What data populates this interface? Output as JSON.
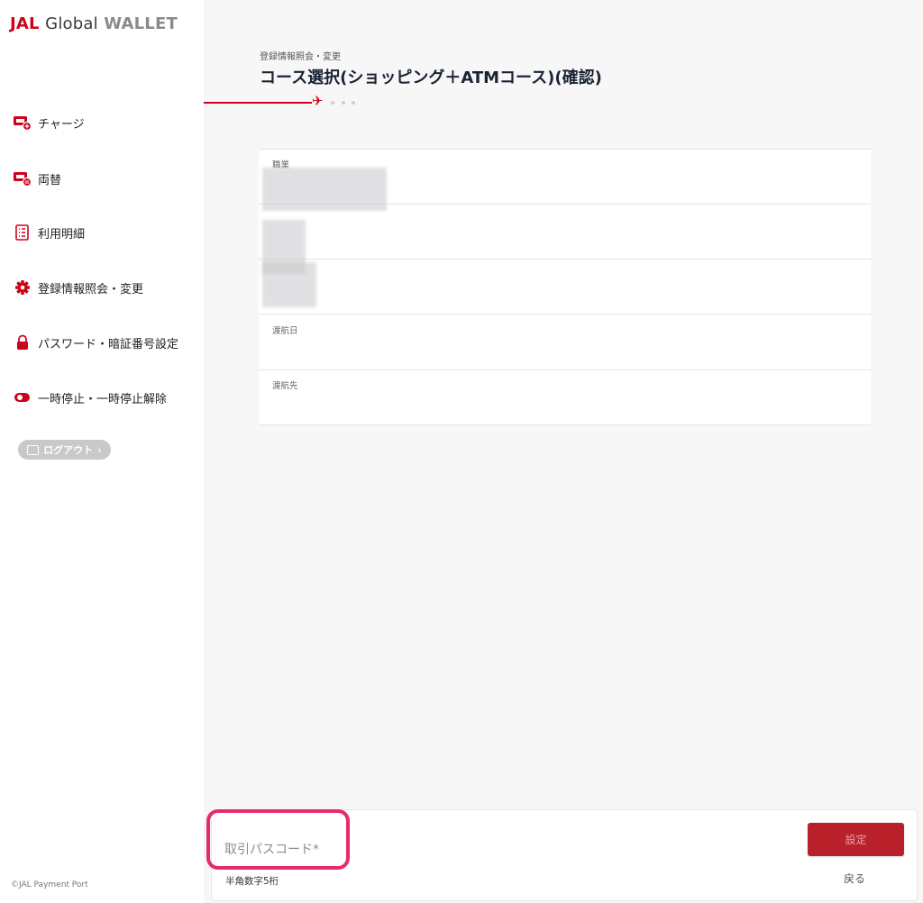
{
  "logo": {
    "jal": "JAL",
    "global": "Global",
    "wallet": "WALLET"
  },
  "sidebar": {
    "items": [
      {
        "label": "チャージ",
        "icon": "charge-icon"
      },
      {
        "label": "両替",
        "icon": "exchange-icon"
      },
      {
        "label": "利用明細",
        "icon": "statement-icon"
      },
      {
        "label": "登録情報照会・変更",
        "icon": "gear-icon"
      },
      {
        "label": "パスワード・暗証番号設定",
        "icon": "lock-icon"
      },
      {
        "label": "一時停止・一時停止解除",
        "icon": "toggle-icon"
      }
    ],
    "logout_label": "ログアウト",
    "copyright": "©JAL Payment Port"
  },
  "main": {
    "breadcrumb": "登録情報照会・変更",
    "title": "コース選択(ショッピング＋ATMコース)(確認)",
    "fields": [
      {
        "label": "職業",
        "value": ""
      },
      {
        "label": "",
        "value": ""
      },
      {
        "label": "",
        "value": ""
      },
      {
        "label": "渡航日",
        "value": ""
      },
      {
        "label": "渡航先",
        "value": ""
      }
    ]
  },
  "footer": {
    "passcode_placeholder": "取引パスコード*",
    "passcode_hint": "半角数字5桁",
    "submit_label": "設定",
    "back_label": "戻る"
  },
  "colors": {
    "brand_red": "#d0021b",
    "button_red": "#b8202a",
    "highlight": "#e8296e"
  }
}
